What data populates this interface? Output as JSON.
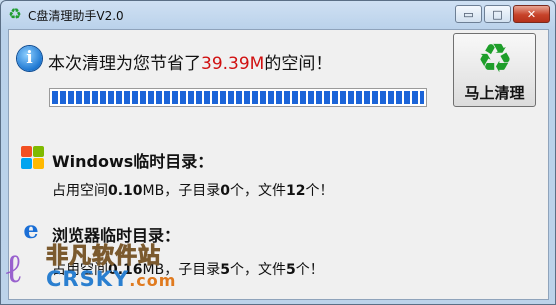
{
  "window": {
    "title": "C盘清理助手V2.0",
    "icon": "recycle-icon",
    "controls": {
      "minimize": "▭",
      "maximize": "□",
      "close": "✕"
    }
  },
  "summary": {
    "prefix": "本次清理为您节省了",
    "amount": "39.39M",
    "suffix": "的空间！",
    "amount_color": "#d01010"
  },
  "progress": {
    "percent": 100,
    "color": "#1b64d8"
  },
  "clean_button": {
    "label": "马上清理",
    "icon": "recycle-icon"
  },
  "windows_section": {
    "title": "Windows临时目录：",
    "icon": "windows-logo-icon",
    "line": {
      "used_label": "占用空间",
      "used_value": "0.10",
      "used_unit": "MB，子目录",
      "subdirs": "0",
      "files_label": "个，文件",
      "files": "12",
      "end": "个！"
    }
  },
  "browser_section": {
    "title": "浏览器临时目录：",
    "icon": "internet-explorer-icon",
    "line": {
      "used_label": "占用空间",
      "used_value": "0.16",
      "used_unit": "MB，子目录",
      "subdirs": "5",
      "files_label": "个，文件",
      "files": "5",
      "end": "个！"
    }
  },
  "watermark": {
    "text": "非凡软件站",
    "url_main": "CRSKY",
    "url_tld": ".com"
  }
}
